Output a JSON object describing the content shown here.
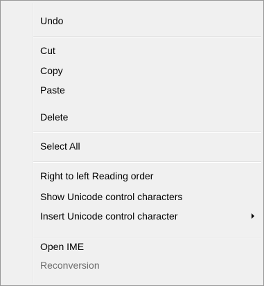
{
  "context_menu": {
    "items": [
      {
        "label": "Undo"
      },
      {
        "label": "Cut"
      },
      {
        "label": "Copy"
      },
      {
        "label": "Paste"
      },
      {
        "label": "Delete"
      },
      {
        "label": "Select All"
      },
      {
        "label": "Right to left Reading order"
      },
      {
        "label": "Show Unicode control characters"
      },
      {
        "label": "Insert Unicode control character",
        "submenu_icon": "chevron-right-icon"
      },
      {
        "label": "Open IME"
      },
      {
        "label": "Reconversion",
        "disabled": true
      }
    ],
    "colors": {
      "background": "#f0f0f0",
      "border": "#979797",
      "text": "#000000",
      "disabled_text": "#6d6d6d",
      "separator": "#e0e0e0"
    }
  }
}
